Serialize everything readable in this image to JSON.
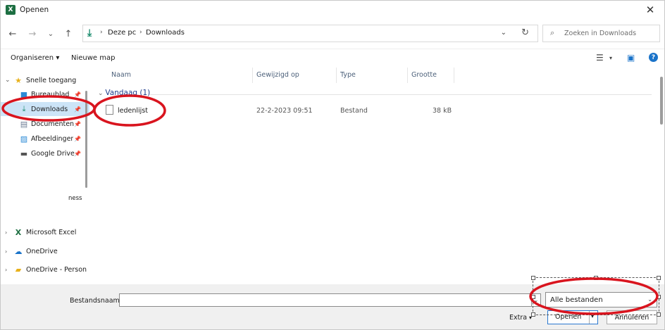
{
  "window": {
    "title": "Openen",
    "app_icon_text": "X"
  },
  "nav": {
    "back": "←",
    "forward": "→",
    "recent": "⌄",
    "up": "↑",
    "breadcrumb": [
      "Deze pc",
      "Downloads"
    ],
    "breadcrumb_sep": "›",
    "search_placeholder": "Zoeken in Downloads"
  },
  "toolbar": {
    "organize": "Organiseren ▾",
    "new_folder": "Nieuwe map"
  },
  "sidebar": {
    "quick_access": "Snelle toegang",
    "items": [
      {
        "label": "Bureaublad",
        "icon": "desktop-icon"
      },
      {
        "label": "Downloads",
        "icon": "download-icon"
      },
      {
        "label": "Documenten",
        "icon": "document-icon"
      },
      {
        "label": "Afbeeldingen",
        "icon": "pictures-icon"
      },
      {
        "label": "Google Drive",
        "icon": "drive-icon"
      }
    ],
    "partial_label": "ness",
    "groups": [
      {
        "label": "Microsoft Excel",
        "icon": "excel-icon"
      },
      {
        "label": "OneDrive",
        "icon": "cloud-icon"
      },
      {
        "label": "OneDrive - Person",
        "icon": "folder-icon"
      }
    ]
  },
  "columns": [
    "Naam",
    "Gewijzigd op",
    "Type",
    "Grootte"
  ],
  "group_header": "Vandaag (1)",
  "files": [
    {
      "name": "ledenlijst",
      "modified": "22-2-2023 09:51",
      "type": "Bestand",
      "size": "38 kB"
    }
  ],
  "bottom": {
    "filename_label": "Bestandsnaam:",
    "filename_value": "",
    "filter": "Alle bestanden",
    "extra": "Extra",
    "open": "Openen",
    "cancel": "Annuleren"
  },
  "colors": {
    "accent": "#1a73c9",
    "selection": "#cce4f7",
    "annotation": "#d9141e",
    "excel": "#1d6f42"
  }
}
